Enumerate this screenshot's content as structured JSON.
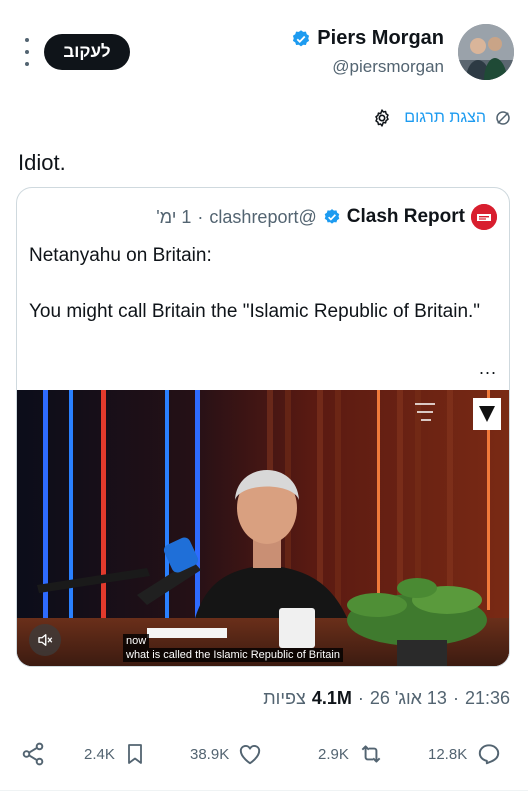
{
  "header": {
    "follow_label": "לעקוב",
    "author_name": "Piers Morgan",
    "author_handle": "@piersmorgan"
  },
  "translate": {
    "label": "הצגת תרגום"
  },
  "tweet": {
    "text": "Idiot."
  },
  "quote": {
    "name": "Clash Report",
    "handle": "@clashreport",
    "separator": "·",
    "time": "1 ימ'",
    "text_line1": "Netanyahu on Britain:",
    "text_line2": "You might call Britain the \"Islamic Republic of Britain.\"",
    "more": "...",
    "video": {
      "caption_line1": "now",
      "caption_line2": "what is called the Islamic Republic of Britain"
    }
  },
  "meta": {
    "time": "21:36",
    "date": "13 אוג' 26",
    "dot": "·",
    "views_count": "4.1M",
    "views_label": "צפיות"
  },
  "actions": {
    "bookmarks": "2.4K",
    "likes": "38.9K",
    "reposts": "2.9K",
    "replies": "12.8K"
  },
  "colors": {
    "accent": "#1d9bf0",
    "text": "#0f1419",
    "secondary": "#536471",
    "border": "#cfd9de"
  }
}
